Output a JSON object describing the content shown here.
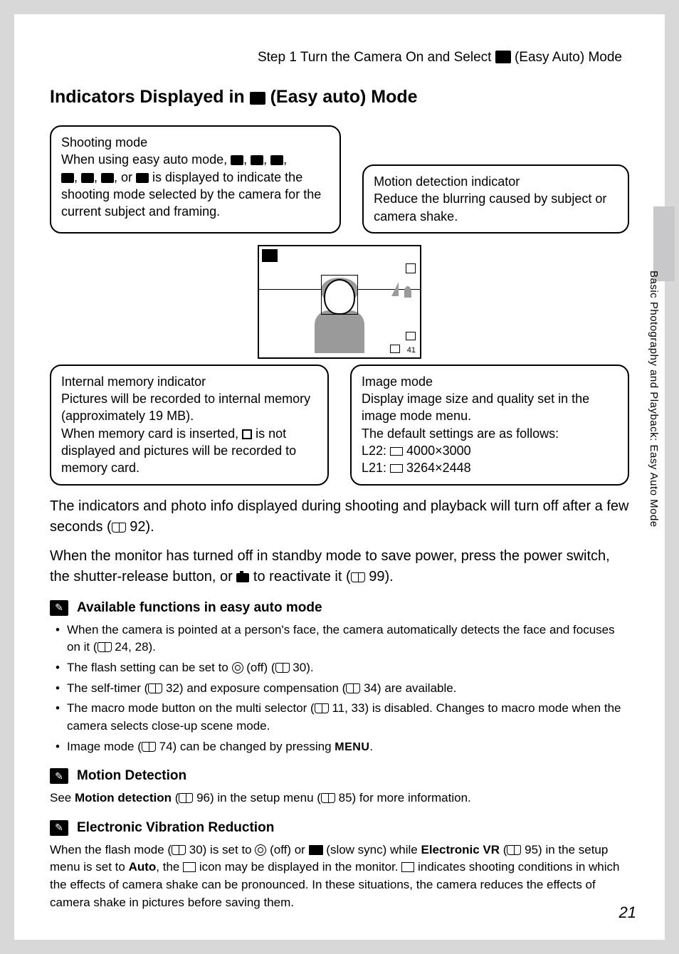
{
  "runningHead": {
    "pre": "Step 1 Turn the Camera On and Select ",
    "post": " (Easy Auto) Mode"
  },
  "heading": {
    "pre": "Indicators Displayed in ",
    "post": " (Easy auto) Mode"
  },
  "callouts": {
    "shootingMode": {
      "title": "Shooting mode",
      "line1a": "When using easy auto mode, ",
      "line1b": ", ",
      "line1c": ", ",
      "line1d": ",",
      "line2a": "",
      "line2b": ", ",
      "line2c": ", ",
      "line2d": ", or ",
      "line2e": " is displayed to",
      "line3": "indicate the shooting mode selected by the camera for the current subject and framing."
    },
    "motion": {
      "title": "Motion detection indicator",
      "body": "Reduce the blurring caused by subject or camera shake."
    },
    "memory": {
      "title": "Internal memory indicator",
      "l1": "Pictures will be recorded to internal memory (approximately 19 MB).",
      "l2a": "When memory card is inserted, ",
      "l2b": " is not displayed and pictures will be recorded to memory card."
    },
    "imageMode": {
      "title": "Image mode",
      "l1": "Display image size and quality set in the image mode menu.",
      "l2": "The default settings are as follows:",
      "l3a": "L22: ",
      "l3b": " 4000×3000",
      "l4a": "L21: ",
      "l4b": " 3264×2448"
    }
  },
  "viewfinder": {
    "frames": "41"
  },
  "para1": {
    "a": "The indicators and photo info displayed during shooting and playback will turn off after a few seconds (",
    "b": " 92)."
  },
  "para2": {
    "a": "When the monitor has turned off in standby mode to save power, press the power switch, the shutter-release button, or ",
    "b": " to reactivate it (",
    "c": " 99)."
  },
  "sections": {
    "available": {
      "title": "Available functions in easy auto mode",
      "b1a": "When the camera is pointed at a person's face, the camera automatically detects the face and focuses on it (",
      "b1b": " 24, 28).",
      "b2a": "The flash setting can be set to ",
      "b2b": " (off) (",
      "b2c": " 30).",
      "b3a": "The self-timer (",
      "b3b": " 32) and exposure compensation (",
      "b3c": " 34) are available.",
      "b4a": "The macro mode button on the multi selector (",
      "b4b": " 11, 33) is disabled. Changes to macro mode when the camera selects close-up scene mode.",
      "b5a": "Image mode (",
      "b5b": " 74) can be changed by pressing ",
      "b5c": "MENU",
      "b5d": "."
    },
    "motionDetect": {
      "title": "Motion Detection",
      "a": "See ",
      "bold": "Motion detection",
      "b": " (",
      "c": " 96) in the setup menu (",
      "d": " 85) for more information."
    },
    "evr": {
      "title": "Electronic Vibration Reduction",
      "a": "When the flash mode (",
      "b": " 30) is set to ",
      "c": " (off) or ",
      "d": " (slow sync) while ",
      "bold1": "Electronic VR",
      "e": " (",
      "f": " 95) in the setup menu is set to ",
      "bold2": "Auto",
      "g": ", the ",
      "h": " icon may be displayed in the monitor. ",
      "i": " indicates shooting conditions in which the effects of camera shake can be pronounced. In these situations, the camera reduces the effects of camera shake in pictures before saving them."
    }
  },
  "sideText": "Basic Photography and Playback: Easy Auto Mode",
  "pageNumber": "21"
}
